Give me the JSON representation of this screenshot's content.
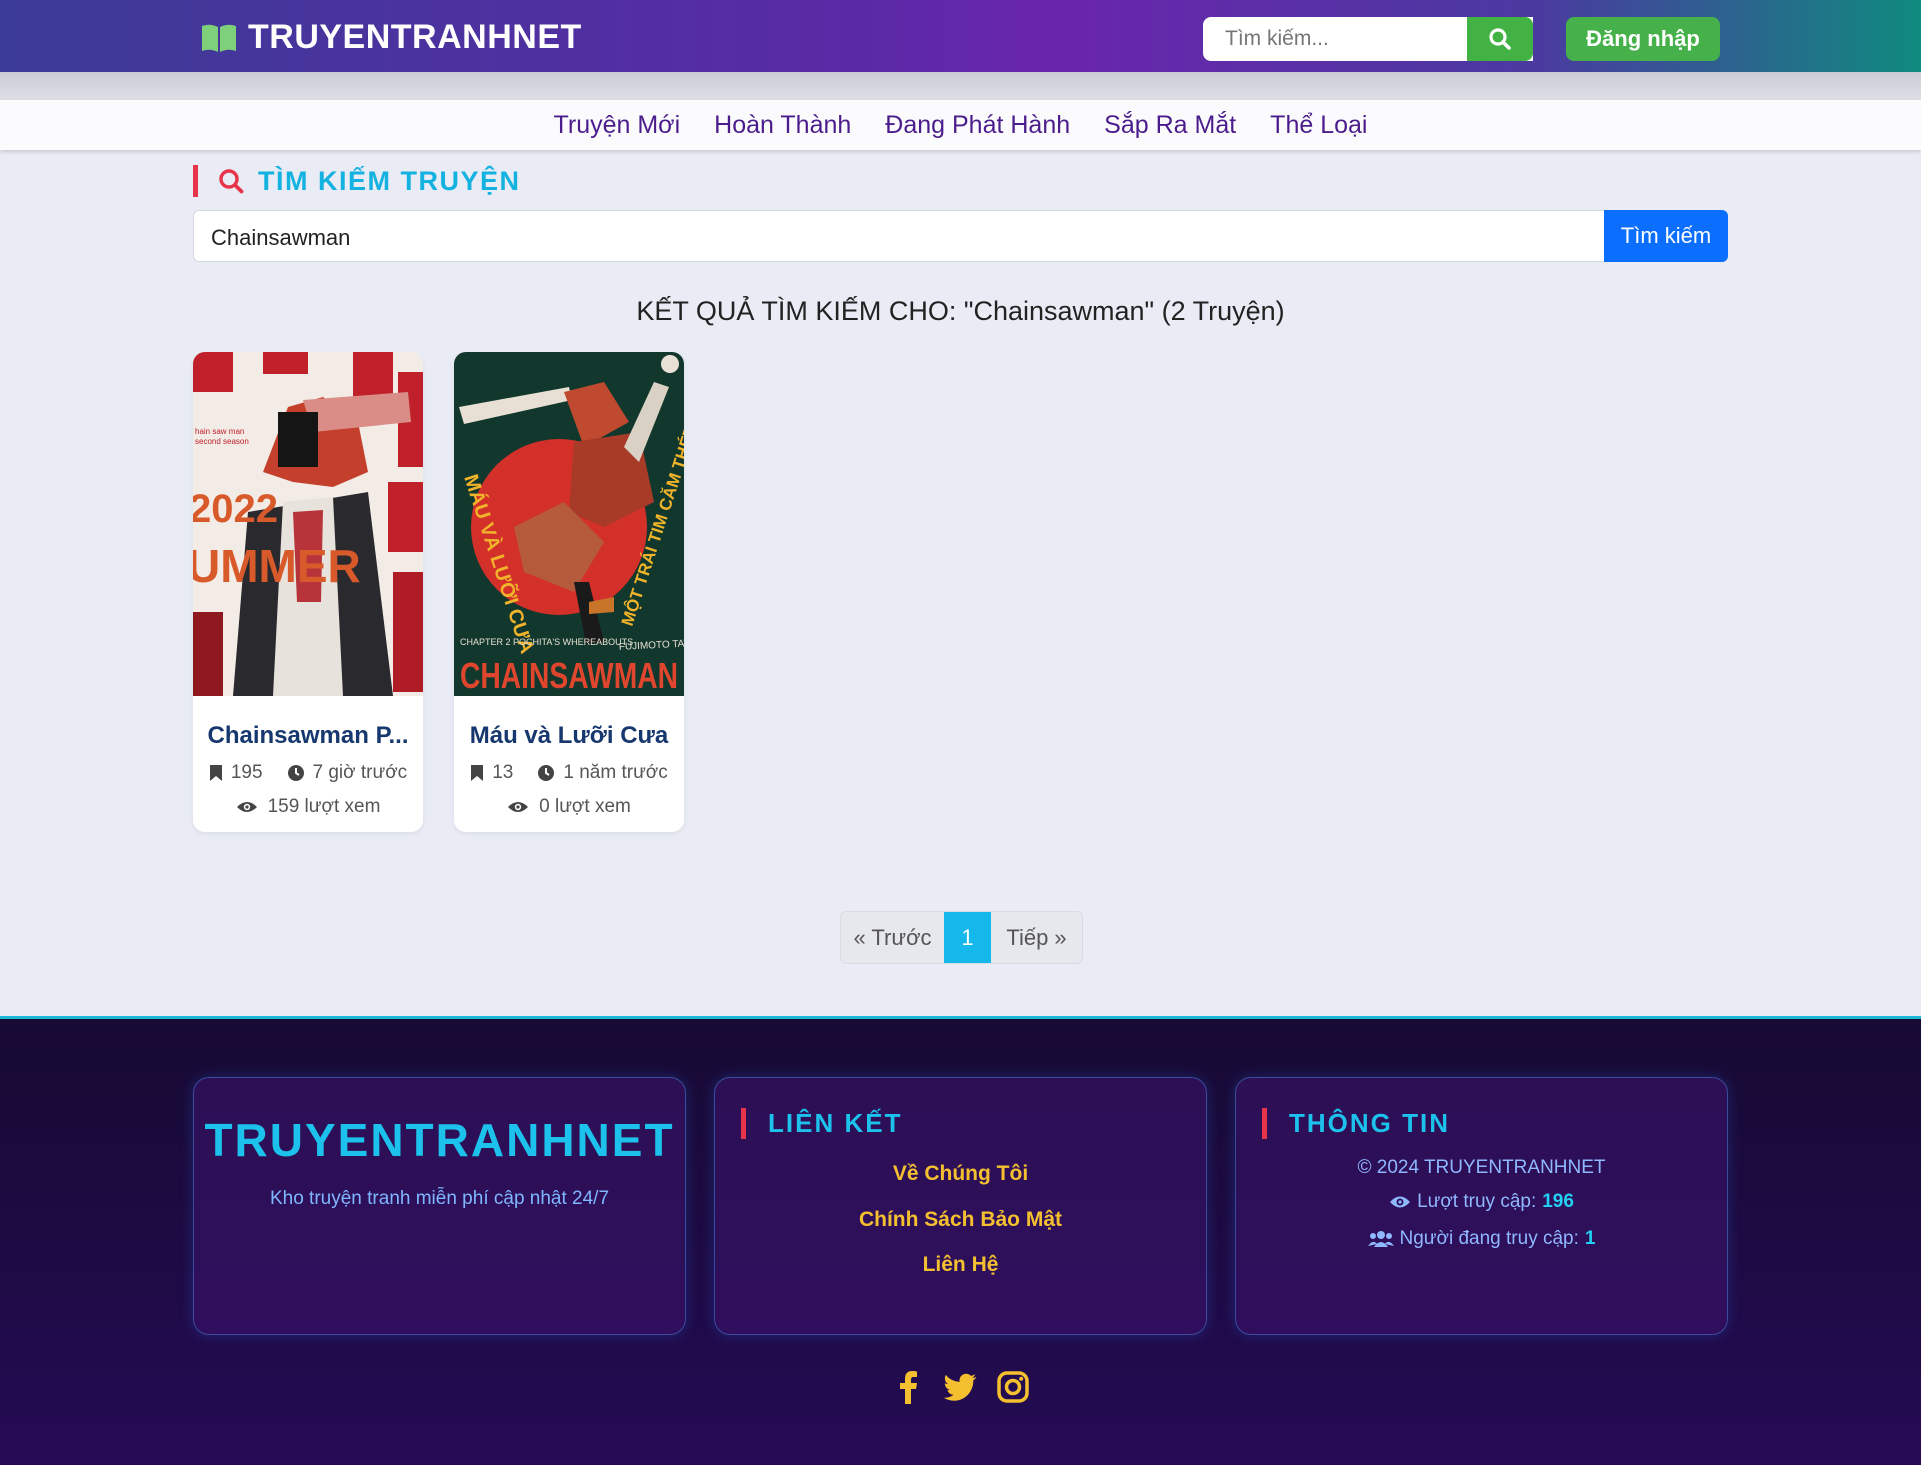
{
  "header": {
    "brand": "TRUYENTRANHNET",
    "search_placeholder": "Tìm kiếm...",
    "login_label": "Đăng nhập"
  },
  "nav": {
    "items": [
      {
        "label": "Truyện Mới"
      },
      {
        "label": "Hoàn Thành"
      },
      {
        "label": "Đang Phát Hành"
      },
      {
        "label": "Sắp Ra Mắt"
      },
      {
        "label": "Thể Loại"
      }
    ]
  },
  "search": {
    "heading": "TÌM KIẾM TRUYỆN",
    "value": "Chainsawman",
    "button_label": "Tìm kiếm",
    "result_title": "KẾT QUẢ TÌM KIẾM CHO: \"Chainsawman\" (2 Truyện)"
  },
  "results": [
    {
      "title": "Chainsawman P...",
      "chapters": "195",
      "updated": "7 giờ trước",
      "views": "159 lượt xem",
      "cover": {
        "bg": "#f3ece6",
        "accent": "#c0202a",
        "text1": "2022",
        "text2": "UMMER",
        "side": "hain saw man second season"
      }
    },
    {
      "title": "Máu và Lưỡi Cưa",
      "chapters": "13",
      "updated": "1 năm trước",
      "views": "0 lượt xem",
      "cover": {
        "bg": "#12382d",
        "accent": "#d4302a",
        "text1": "CHAINSAWMAN",
        "text2": "MÁU VÀ LƯỠI CƯA",
        "text3": "MỘT TRÁI TIM CĂM THÉT",
        "text4": "CHAPTER 2 POCHITA'S WHEREABOUTS",
        "text5": "FUJIMOTO TATSUKI"
      }
    }
  ],
  "pagination": {
    "prev": "« Trước",
    "current": "1",
    "next": "Tiếp »"
  },
  "footer": {
    "brand": "TRUYENTRANHNET",
    "tagline": "Kho truyện tranh miễn phí cập nhật 24/7",
    "links_heading": "LIÊN KẾT",
    "links": [
      "Về Chúng Tôi",
      "Chính Sách Bảo Mật",
      "Liên Hệ"
    ],
    "info_heading": "THÔNG TIN",
    "copyright": "© 2024 TRUYENTRANHNET",
    "visits_label": "Lượt truy cập:",
    "visits_value": "196",
    "online_label": "Người đang truy cập:",
    "online_value": "1"
  },
  "colors": {
    "accent": "#14b2e0",
    "nav_text": "#4b1d8c",
    "login_green": "#46b14a",
    "footer_link": "#f4c02f"
  }
}
